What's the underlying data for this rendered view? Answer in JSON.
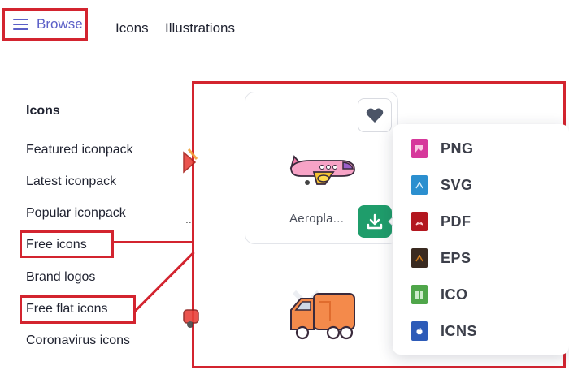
{
  "nav": {
    "browse_label": "Browse",
    "links": [
      "Icons",
      "Illustrations"
    ]
  },
  "sidebar": {
    "title": "Icons",
    "items": [
      "Featured iconpack",
      "Latest iconpack",
      "Popular iconpack",
      "Free icons",
      "Brand logos",
      "Free flat icons",
      "Coronavirus icons"
    ]
  },
  "card": {
    "caption": "Aeropla...",
    "icon": "airplane-illustration"
  },
  "second_card": {
    "icon": "delivery-truck-illustration"
  },
  "download_menu": {
    "formats": [
      {
        "label": "PNG",
        "color": "#d6389b"
      },
      {
        "label": "SVG",
        "color": "#2b8fcf"
      },
      {
        "label": "PDF",
        "color": "#b3171f"
      },
      {
        "label": "EPS",
        "color": "#c97618"
      },
      {
        "label": "ICO",
        "color": "#4fa64a"
      },
      {
        "label": "ICNS",
        "color": "#2d5bb8"
      }
    ]
  },
  "colors": {
    "accent": "#5b5fc7",
    "highlight_red": "#d3242f",
    "download_green": "#1f9d6b"
  }
}
